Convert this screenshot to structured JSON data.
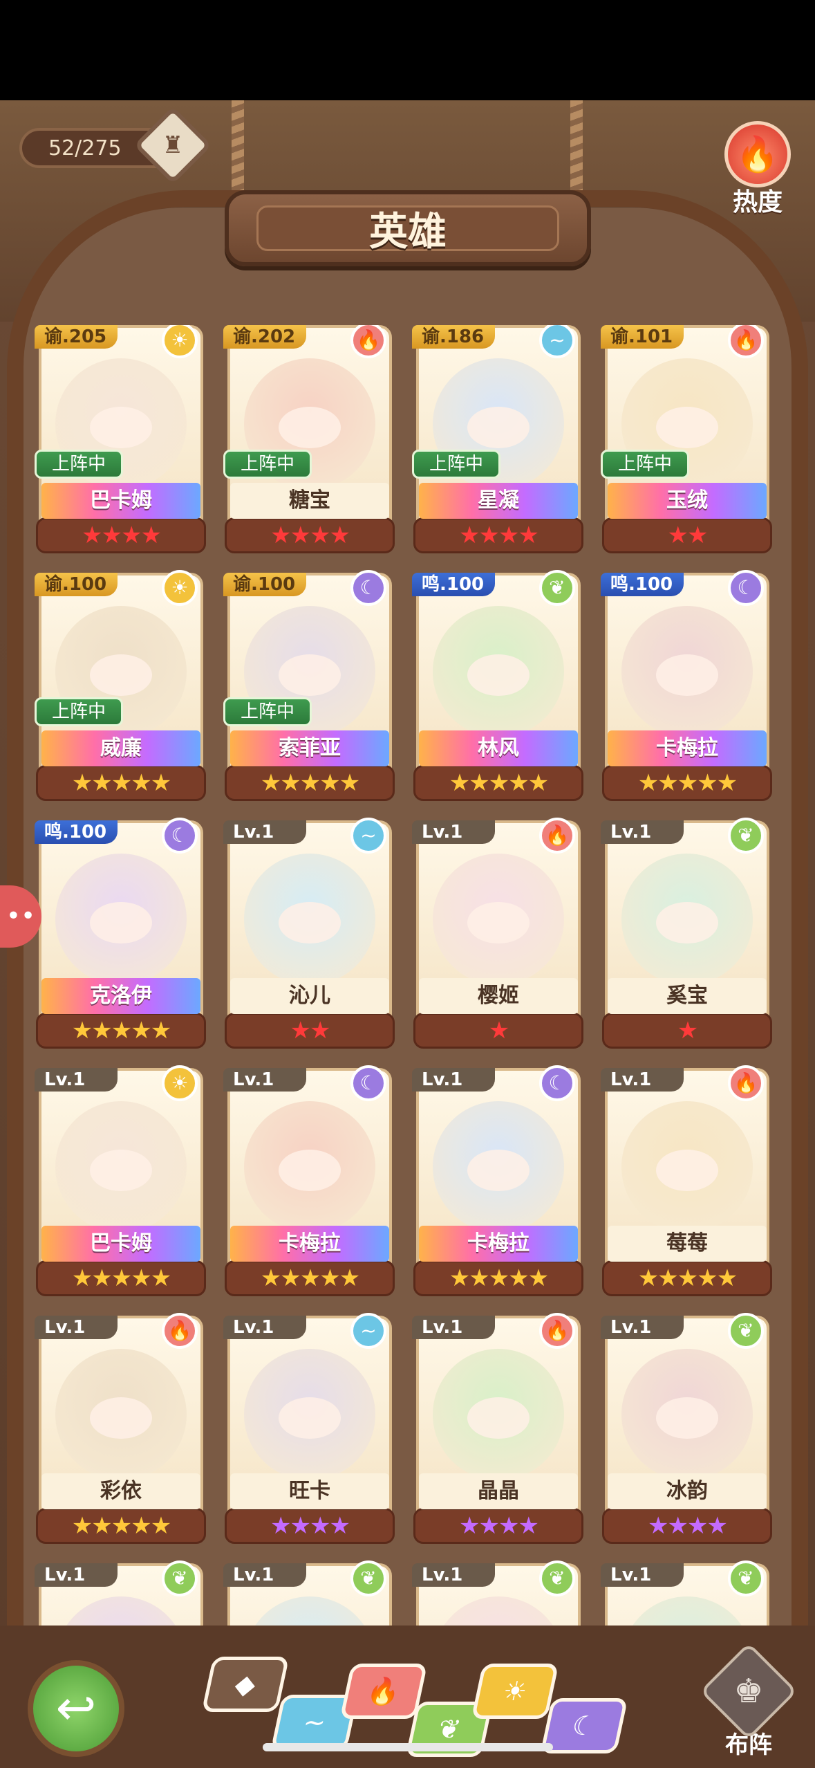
{
  "header": {
    "counter": "52/275",
    "title": "英雄",
    "heat_label": "热度"
  },
  "heroes": [
    {
      "level": "谕.205",
      "name": "巴卡姆",
      "element": "light",
      "badge": "上阵中",
      "stars": "★★★★",
      "star_color": "red",
      "name_style": "rainbow"
    },
    {
      "level": "谕.202",
      "name": "糖宝",
      "element": "fire",
      "badge": "上阵中",
      "stars": "★★★★",
      "star_color": "red",
      "name_style": "plain"
    },
    {
      "level": "谕.186",
      "name": "星凝",
      "element": "water",
      "badge": "上阵中",
      "stars": "★★★★",
      "star_color": "red",
      "name_style": "rainbow"
    },
    {
      "level": "谕.101",
      "name": "玉绒",
      "element": "fire",
      "badge": "上阵中",
      "stars": "★★",
      "star_color": "red",
      "name_style": "rainbow"
    },
    {
      "level": "谕.100",
      "name": "威廉",
      "element": "light",
      "badge": "上阵中",
      "stars": "★★★★★",
      "star_color": "gold",
      "name_style": "rainbow"
    },
    {
      "level": "谕.100",
      "name": "索菲亚",
      "element": "dark",
      "badge": "上阵中",
      "stars": "★★★★★",
      "star_color": "gold",
      "name_style": "rainbow"
    },
    {
      "level": "鸣.100",
      "name": "林风",
      "element": "grass",
      "badge": "",
      "stars": "★★★★★",
      "star_color": "gold",
      "name_style": "rainbow"
    },
    {
      "level": "鸣.100",
      "name": "卡梅拉",
      "element": "dark",
      "badge": "",
      "stars": "★★★★★",
      "star_color": "gold",
      "name_style": "rainbow"
    },
    {
      "level": "鸣.100",
      "name": "克洛伊",
      "element": "dark",
      "badge": "",
      "stars": "★★★★★",
      "star_color": "gold",
      "name_style": "rainbow"
    },
    {
      "level": "Lv.1",
      "name": "沁儿",
      "element": "water",
      "badge": "",
      "stars": "★★",
      "star_color": "red",
      "name_style": "plain"
    },
    {
      "level": "Lv.1",
      "name": "樱姬",
      "element": "fire",
      "badge": "",
      "stars": "★",
      "star_color": "red",
      "name_style": "plain"
    },
    {
      "level": "Lv.1",
      "name": "奚宝",
      "element": "grass",
      "badge": "",
      "stars": "★",
      "star_color": "red",
      "name_style": "plain"
    },
    {
      "level": "Lv.1",
      "name": "巴卡姆",
      "element": "light",
      "badge": "",
      "stars": "★★★★★",
      "star_color": "gold",
      "name_style": "rainbow"
    },
    {
      "level": "Lv.1",
      "name": "卡梅拉",
      "element": "dark",
      "badge": "",
      "stars": "★★★★★",
      "star_color": "gold",
      "name_style": "rainbow"
    },
    {
      "level": "Lv.1",
      "name": "卡梅拉",
      "element": "dark",
      "badge": "",
      "stars": "★★★★★",
      "star_color": "gold",
      "name_style": "rainbow"
    },
    {
      "level": "Lv.1",
      "name": "莓莓",
      "element": "fire",
      "badge": "",
      "stars": "★★★★★",
      "star_color": "gold",
      "name_style": "plain"
    },
    {
      "level": "Lv.1",
      "name": "彩依",
      "element": "fire",
      "badge": "",
      "stars": "★★★★★",
      "star_color": "gold",
      "name_style": "plain"
    },
    {
      "level": "Lv.1",
      "name": "旺卡",
      "element": "water",
      "badge": "",
      "stars": "★★★★",
      "star_color": "purple",
      "name_style": "plain"
    },
    {
      "level": "Lv.1",
      "name": "晶晶",
      "element": "fire",
      "badge": "",
      "stars": "★★★★",
      "star_color": "purple",
      "name_style": "plain"
    },
    {
      "level": "Lv.1",
      "name": "冰韵",
      "element": "grass",
      "badge": "",
      "stars": "★★★★",
      "star_color": "purple",
      "name_style": "plain"
    },
    {
      "level": "Lv.1",
      "name": "",
      "element": "grass",
      "badge": "",
      "stars": "",
      "star_color": "gold",
      "name_style": "plain"
    },
    {
      "level": "Lv.1",
      "name": "",
      "element": "grass",
      "badge": "",
      "stars": "",
      "star_color": "gold",
      "name_style": "plain"
    },
    {
      "level": "Lv.1",
      "name": "",
      "element": "grass",
      "badge": "",
      "stars": "",
      "star_color": "gold",
      "name_style": "plain"
    },
    {
      "level": "Lv.1",
      "name": "",
      "element": "grass",
      "badge": "",
      "stars": "",
      "star_color": "gold",
      "name_style": "plain"
    }
  ],
  "element_icons": {
    "light": "sun-icon",
    "fire": "flame-icon",
    "water": "water-drop-icon",
    "grass": "leaf-icon",
    "dark": "moon-icon"
  },
  "element_glyphs": {
    "light": "☀",
    "fire": "🔥",
    "water": "~",
    "grass": "❦",
    "dark": "☾"
  },
  "filters": [
    {
      "name": "all",
      "glyph": "◆",
      "color": "#7a5a45"
    },
    {
      "name": "water",
      "glyph": "~",
      "color": "#6cc6e5"
    },
    {
      "name": "fire",
      "glyph": "🔥",
      "color": "#f07f7a"
    },
    {
      "name": "grass",
      "glyph": "❦",
      "color": "#8fcc5a"
    },
    {
      "name": "light",
      "glyph": "☀",
      "color": "#f3c23b"
    },
    {
      "name": "dark",
      "glyph": "☾",
      "color": "#9b7be0"
    }
  ],
  "footer": {
    "lineup_label": "布阵"
  }
}
